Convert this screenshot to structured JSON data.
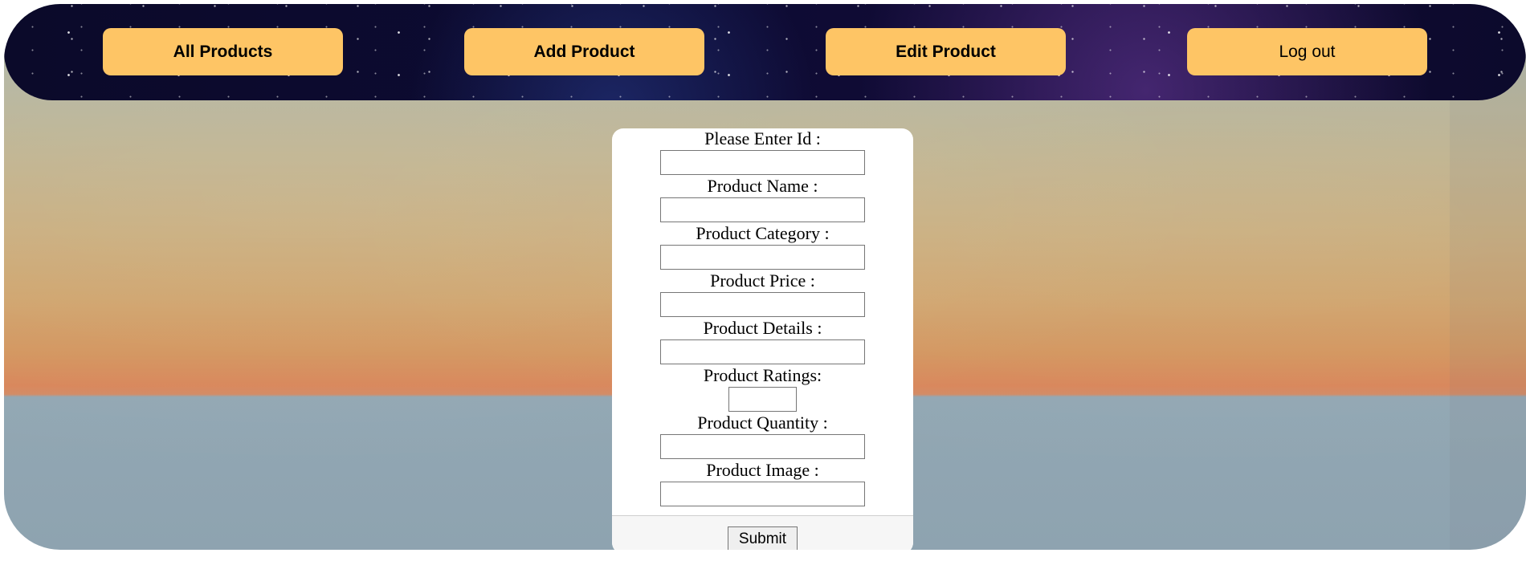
{
  "nav": {
    "all_products": "All Products",
    "add_product": "Add Product",
    "edit_product": "Edit Product",
    "logout": "Log out"
  },
  "form": {
    "id_label": "Please Enter Id :",
    "name_label": "Product Name :",
    "category_label": "Product Category :",
    "price_label": "Product Price :",
    "details_label": "Product Details :",
    "ratings_label": "Product Ratings:",
    "quantity_label": "Product Quantity :",
    "image_label": "Product Image :",
    "id_value": "",
    "name_value": "",
    "category_value": "",
    "price_value": "",
    "details_value": "",
    "ratings_value": "",
    "quantity_value": "",
    "image_value": "",
    "submit_label": "Submit"
  },
  "colors": {
    "nav_button": "#fec565",
    "navbar_bg": "#0d0b33",
    "card_bg": "#ffffff"
  }
}
